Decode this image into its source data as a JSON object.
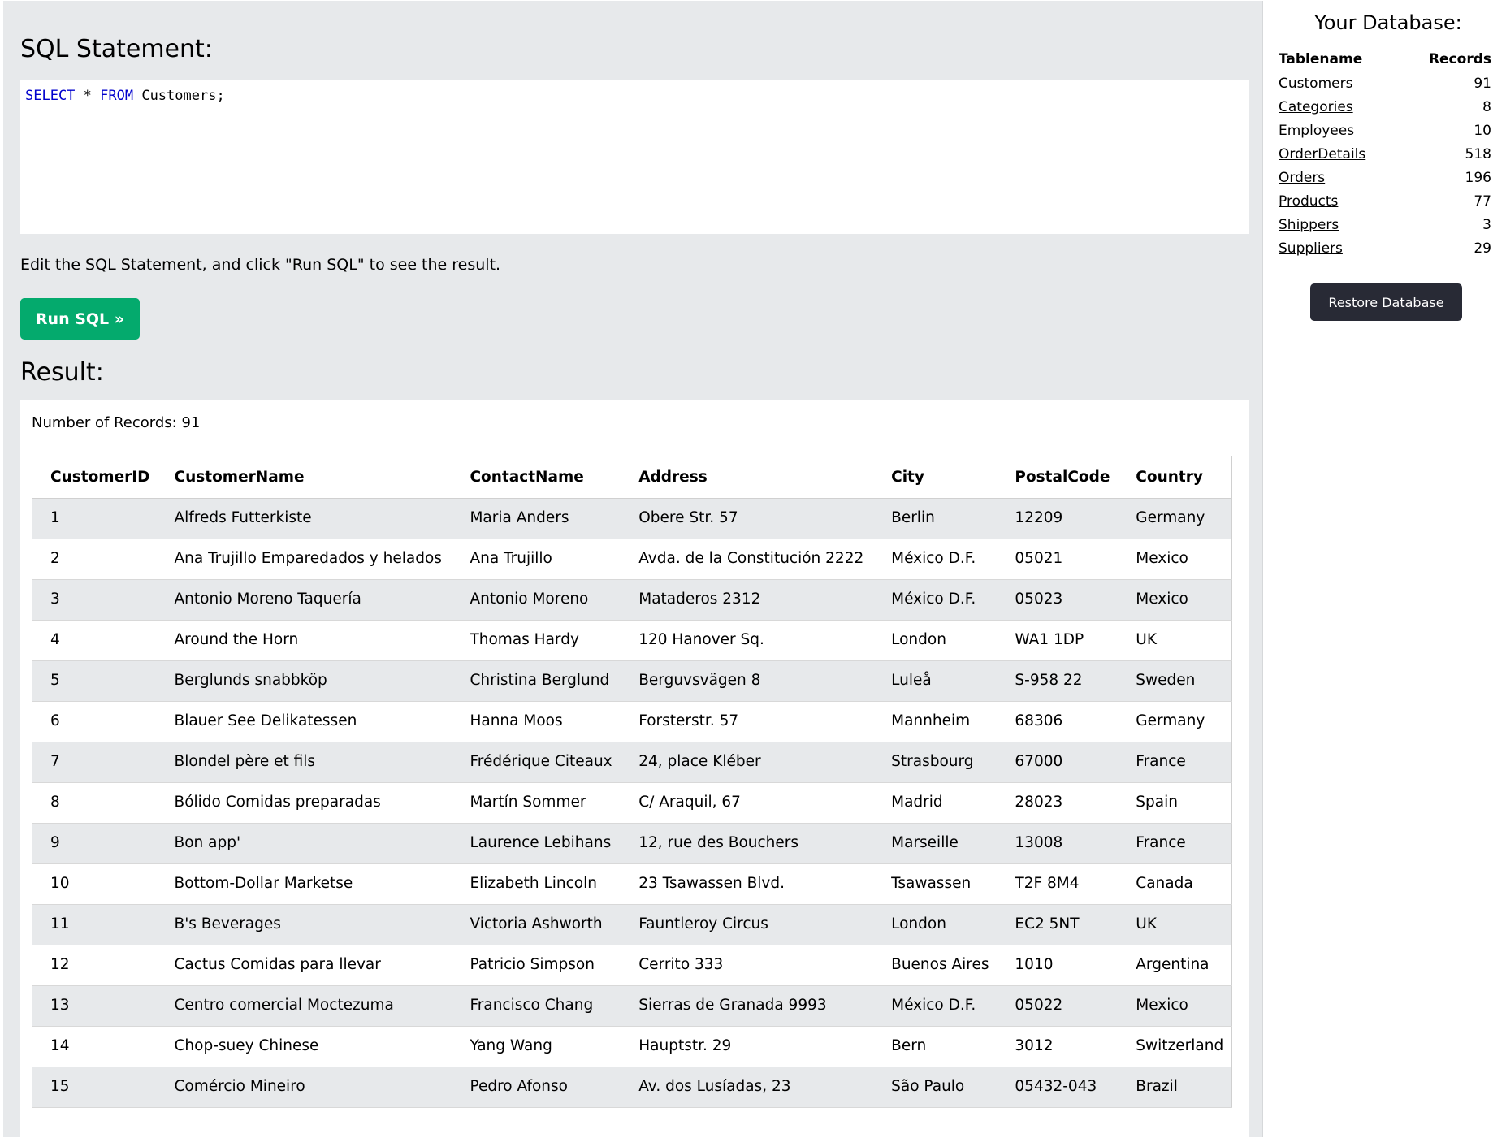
{
  "editor": {
    "heading": "SQL Statement:",
    "query_keyword1": "SELECT",
    "query_mid": " * ",
    "query_keyword2": "FROM",
    "query_rest": " Customers;",
    "hint": "Edit the SQL Statement, and click \"Run SQL\" to see the result.",
    "run_label": "Run SQL »"
  },
  "result": {
    "heading": "Result:",
    "num_records": "Number of Records: 91",
    "columns": [
      "CustomerID",
      "CustomerName",
      "ContactName",
      "Address",
      "City",
      "PostalCode",
      "Country"
    ],
    "rows": [
      [
        "1",
        "Alfreds Futterkiste",
        "Maria Anders",
        "Obere Str. 57",
        "Berlin",
        "12209",
        "Germany"
      ],
      [
        "2",
        "Ana Trujillo Emparedados y helados",
        "Ana Trujillo",
        "Avda. de la Constitución 2222",
        "México D.F.",
        "05021",
        "Mexico"
      ],
      [
        "3",
        "Antonio Moreno Taquería",
        "Antonio Moreno",
        "Mataderos 2312",
        "México D.F.",
        "05023",
        "Mexico"
      ],
      [
        "4",
        "Around the Horn",
        "Thomas Hardy",
        "120 Hanover Sq.",
        "London",
        "WA1 1DP",
        "UK"
      ],
      [
        "5",
        "Berglunds snabbköp",
        "Christina Berglund",
        "Berguvsvägen 8",
        "Luleå",
        "S-958 22",
        "Sweden"
      ],
      [
        "6",
        "Blauer See Delikatessen",
        "Hanna Moos",
        "Forsterstr. 57",
        "Mannheim",
        "68306",
        "Germany"
      ],
      [
        "7",
        "Blondel père et fils",
        "Frédérique Citeaux",
        "24, place Kléber",
        "Strasbourg",
        "67000",
        "France"
      ],
      [
        "8",
        "Bólido Comidas preparadas",
        "Martín Sommer",
        "C/ Araquil, 67",
        "Madrid",
        "28023",
        "Spain"
      ],
      [
        "9",
        "Bon app'",
        "Laurence Lebihans",
        "12, rue des Bouchers",
        "Marseille",
        "13008",
        "France"
      ],
      [
        "10",
        "Bottom-Dollar Marketse",
        "Elizabeth Lincoln",
        "23 Tsawassen Blvd.",
        "Tsawassen",
        "T2F 8M4",
        "Canada"
      ],
      [
        "11",
        "B's Beverages",
        "Victoria Ashworth",
        "Fauntleroy Circus",
        "London",
        "EC2 5NT",
        "UK"
      ],
      [
        "12",
        "Cactus Comidas para llevar",
        "Patricio Simpson",
        "Cerrito 333",
        "Buenos Aires",
        "1010",
        "Argentina"
      ],
      [
        "13",
        "Centro comercial Moctezuma",
        "Francisco Chang",
        "Sierras de Granada 9993",
        "México D.F.",
        "05022",
        "Mexico"
      ],
      [
        "14",
        "Chop-suey Chinese",
        "Yang Wang",
        "Hauptstr. 29",
        "Bern",
        "3012",
        "Switzerland"
      ],
      [
        "15",
        "Comércio Mineiro",
        "Pedro Afonso",
        "Av. dos Lusíadas, 23",
        "São Paulo",
        "05432-043",
        "Brazil"
      ]
    ]
  },
  "database": {
    "title": "Your Database:",
    "col_table": "Tablename",
    "col_records": "Records",
    "tables": [
      {
        "name": "Customers",
        "records": "91"
      },
      {
        "name": "Categories",
        "records": "8"
      },
      {
        "name": "Employees",
        "records": "10"
      },
      {
        "name": "OrderDetails",
        "records": "518"
      },
      {
        "name": "Orders",
        "records": "196"
      },
      {
        "name": "Products",
        "records": "77"
      },
      {
        "name": "Shippers",
        "records": "3"
      },
      {
        "name": "Suppliers",
        "records": "29"
      }
    ],
    "restore_label": "Restore Database"
  }
}
